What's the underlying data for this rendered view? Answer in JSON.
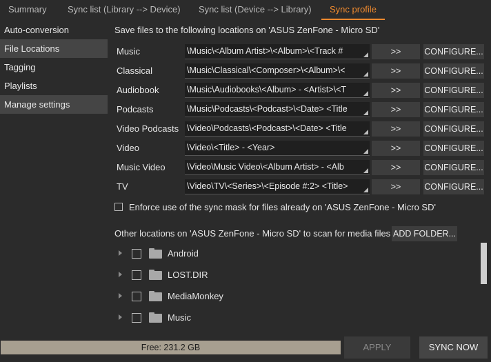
{
  "tabs": [
    "Summary",
    "Sync list (Library --> Device)",
    "Sync list (Device --> Library)",
    "Sync profile"
  ],
  "active_tab": "Sync profile",
  "sidebar": {
    "items": [
      "Auto-conversion",
      "File Locations",
      "Tagging",
      "Playlists",
      "Manage settings"
    ],
    "selected": [
      "File Locations",
      "Manage settings"
    ]
  },
  "main": {
    "heading": "Save files to the following locations on 'ASUS ZenFone - Micro SD'",
    "arrow_label": ">>",
    "configure_label": "CONFIGURE...",
    "locations": [
      {
        "label": "Music",
        "path": "\\Music\\<Album Artist>\\<Album>\\<Track #"
      },
      {
        "label": "Classical",
        "path": "\\Music\\Classical\\<Composer>\\<Album>\\<"
      },
      {
        "label": "Audiobook",
        "path": "\\Music\\Audiobooks\\<Album> - <Artist>\\<T"
      },
      {
        "label": "Podcasts",
        "path": "\\Music\\Podcasts\\<Podcast>\\<Date> <Title"
      },
      {
        "label": "Video Podcasts",
        "path": "\\Video\\Podcasts\\<Podcast>\\<Date> <Title"
      },
      {
        "label": "Video",
        "path": "\\Video\\<Title> - <Year>"
      },
      {
        "label": "Music Video",
        "path": "\\Video\\Music Video\\<Album Artist> - <Alb"
      },
      {
        "label": "TV",
        "path": "\\Video\\TV\\<Series>\\<Episode #:2> <Title>"
      }
    ],
    "enforce_label": "Enforce use of the sync mask for files already on 'ASUS ZenFone - Micro SD'",
    "enforce_checked": false,
    "other_locations_label": "Other locations on 'ASUS ZenFone - Micro SD' to scan for media files",
    "add_folder_label": "ADD FOLDER...",
    "folders": [
      {
        "name": "Android",
        "checked": false
      },
      {
        "name": "LOST.DIR",
        "checked": false
      },
      {
        "name": "MediaMonkey",
        "checked": false
      },
      {
        "name": "Music",
        "checked": false
      }
    ]
  },
  "footer": {
    "free_label": "Free: 231.2 GB",
    "apply_label": "APPLY",
    "apply_enabled": false,
    "sync_label": "SYNC NOW"
  },
  "colors": {
    "background": "#2b2b2b",
    "accent": "#ef8a2f",
    "button": "#3d3d3d",
    "selected_item": "#454545"
  }
}
